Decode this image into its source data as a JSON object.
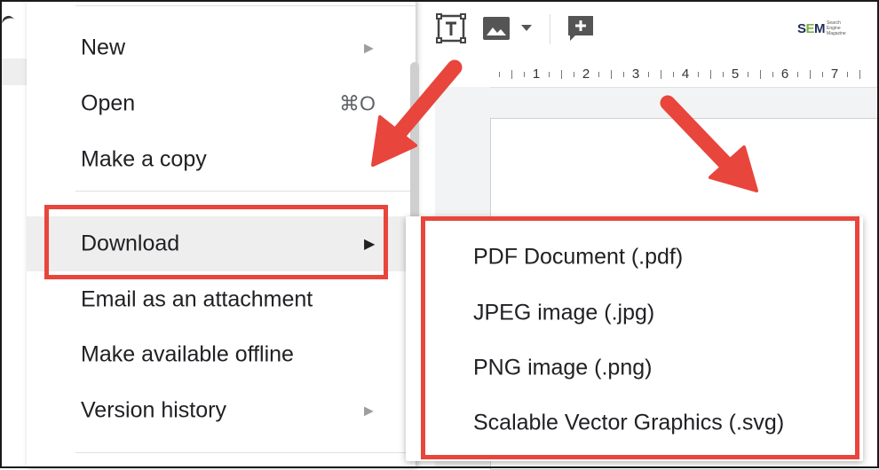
{
  "file_menu": {
    "items": [
      {
        "label": "New",
        "submenu": true
      },
      {
        "label": "Open",
        "shortcut": "⌘O"
      },
      {
        "label": "Make a copy"
      },
      {
        "label": "Download",
        "submenu": true,
        "highlighted": true
      },
      {
        "label": "Email as an attachment"
      },
      {
        "label": "Make available offline"
      },
      {
        "label": "Version history",
        "submenu": true
      }
    ]
  },
  "download_submenu": {
    "items": [
      {
        "label": "PDF Document (.pdf)"
      },
      {
        "label": "JPEG image (.jpg)"
      },
      {
        "label": "PNG image (.png)"
      },
      {
        "label": "Scalable Vector Graphics (.svg)"
      }
    ]
  },
  "toolbar": {
    "icons": [
      "text-box-icon",
      "image-icon",
      "dropdown-caret-icon",
      "add-comment-icon"
    ]
  },
  "ruler": {
    "numbers": [
      "1",
      "2",
      "3",
      "4",
      "5",
      "6",
      "7"
    ]
  },
  "watermark": {
    "brand": "SEM",
    "tagline": "Search Engine Magazine"
  },
  "colors": {
    "annotation_red": "#e8453c",
    "menu_text": "#202124",
    "hover_bg": "#eeeeee",
    "canvas_bg": "#f1f3f4"
  }
}
